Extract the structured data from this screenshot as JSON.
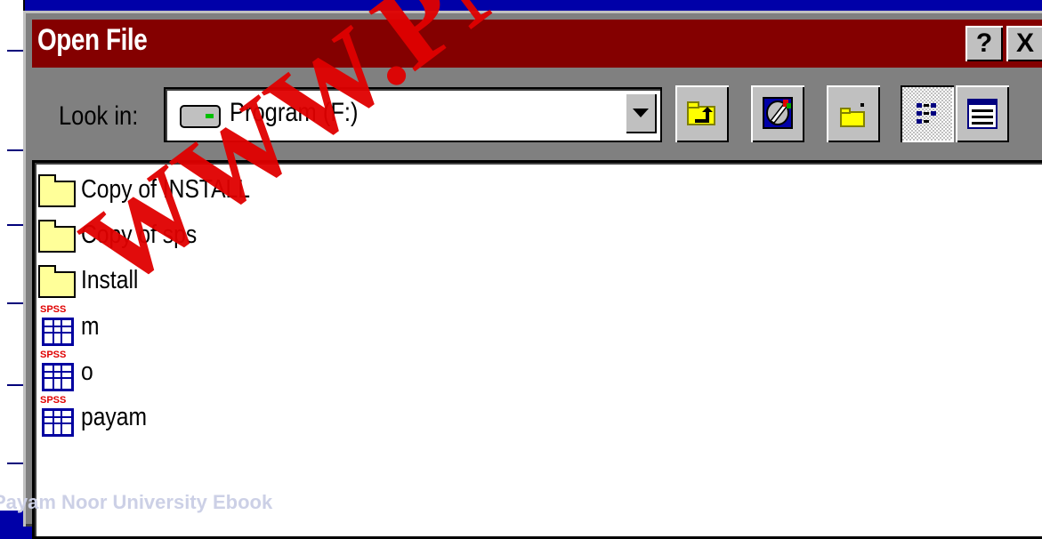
{
  "dialog": {
    "title": "Open File",
    "help_label": "?",
    "close_label": "X"
  },
  "toolbar": {
    "look_in_label": "Look in:",
    "look_in_value": "Program (F:)",
    "buttons": [
      "up-one-level-icon",
      "desktop-icon",
      "create-new-folder-icon",
      "list-view-icon",
      "details-view-icon"
    ]
  },
  "files": [
    {
      "name": "Copy of INSTALL",
      "type": "folder"
    },
    {
      "name": "Copy of sps",
      "type": "folder"
    },
    {
      "name": "Install",
      "type": "folder"
    },
    {
      "name": "m",
      "type": "spss-data"
    },
    {
      "name": "o",
      "type": "spss-data"
    },
    {
      "name": "payam",
      "type": "spss-data"
    }
  ],
  "spss_tag": "SPSS",
  "watermark": "WWW.PNU",
  "footer": "Payam Noor University Ebook",
  "colors": {
    "desktop": "#0000a8",
    "titlebar": "#840000",
    "dialog_face": "#808080",
    "watermark": "#e00000"
  }
}
